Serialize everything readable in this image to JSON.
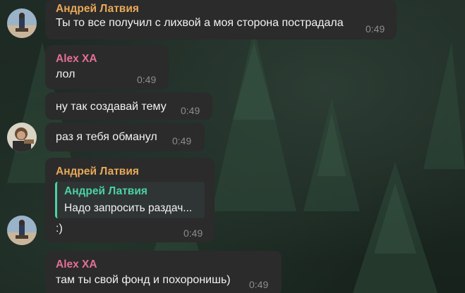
{
  "messages": [
    {
      "sender": "Андрей Латвия",
      "text": "Ты то все получил с лихвой а моя сторона пострадала",
      "time": "0:49"
    },
    {
      "sender": "Alex XA",
      "text": "лол",
      "time": "0:49"
    },
    {
      "text": "ну так создавай тему",
      "time": "0:49"
    },
    {
      "text": "раз я тебя обманул",
      "time": "0:49"
    },
    {
      "sender": "Андрей Латвия",
      "reply": {
        "sender": "Андрей Латвия",
        "text": "Надо запросить раздач..."
      },
      "text": ":)",
      "time": "0:49"
    },
    {
      "sender": "Alex XA",
      "text": "там ты свой фонд и похоронишь)",
      "time": "0:49"
    }
  ],
  "colors": {
    "bubble": "#2b2b2b",
    "andrey_name": "#e8a959",
    "alex_name": "#e36f97",
    "reply_accent": "#4cd1a4",
    "time": "#8d8d8d"
  },
  "icons": [
    "avatar-andrey-icon",
    "avatar-alex-icon"
  ]
}
